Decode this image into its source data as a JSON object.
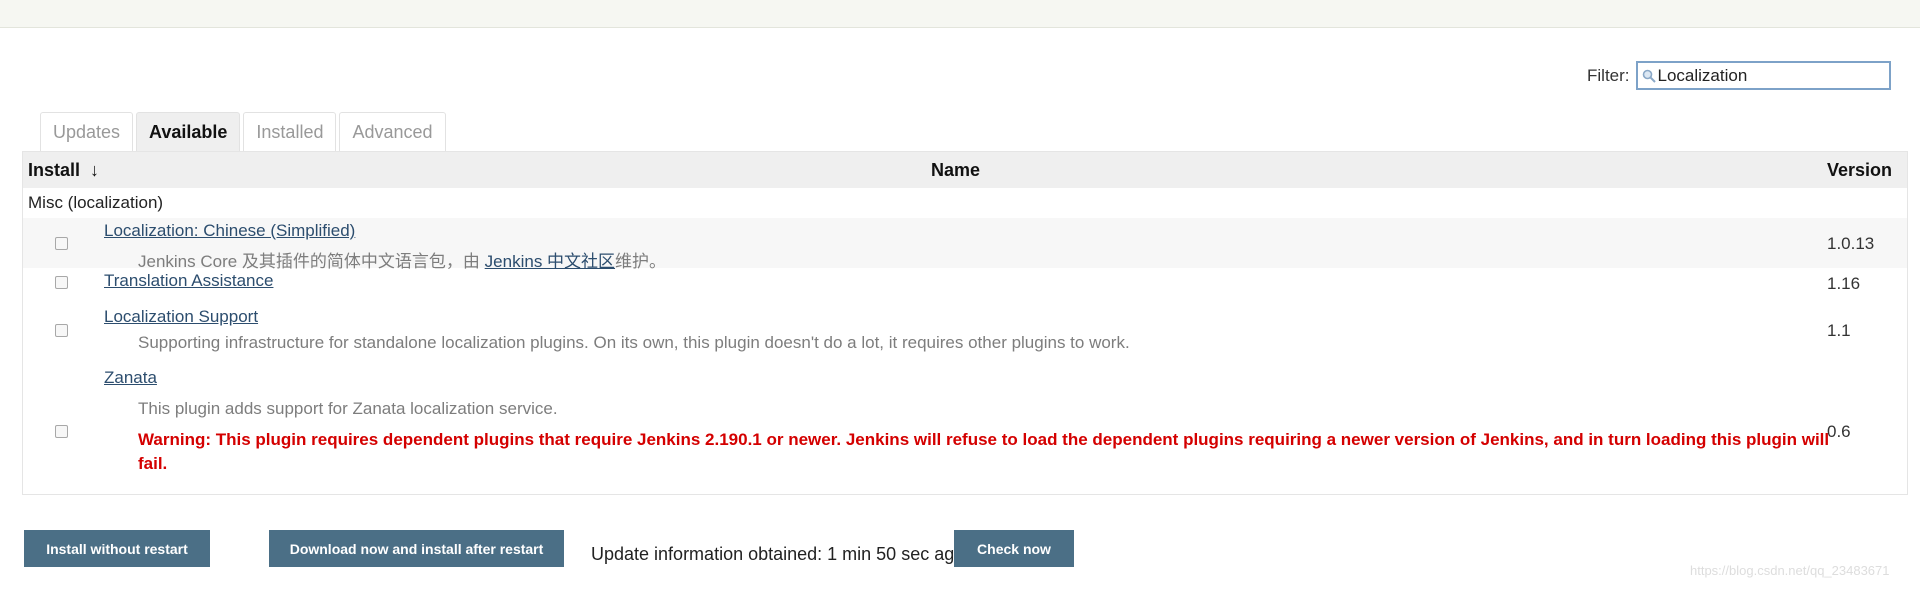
{
  "filter": {
    "label": "Filter:",
    "value": "Localization"
  },
  "tabs": [
    {
      "label": "Updates",
      "active": false
    },
    {
      "label": "Available",
      "active": true
    },
    {
      "label": "Installed",
      "active": false
    },
    {
      "label": "Advanced",
      "active": false
    }
  ],
  "table": {
    "headers": {
      "install": "Install",
      "sort_arrow": "↓",
      "name": "Name",
      "version": "Version"
    },
    "category": "Misc (localization)",
    "plugins": [
      {
        "name": "Localization: Chinese (Simplified)",
        "desc_prefix": "Jenkins Core 及其插件的简体中文语言包，由 ",
        "desc_link": "Jenkins 中文社区",
        "desc_suffix": "维护。",
        "version": "1.0.13"
      },
      {
        "name": "Translation Assistance",
        "version": "1.16"
      },
      {
        "name": "Localization Support",
        "desc": "Supporting infrastructure for standalone localization plugins. On its own, this plugin doesn't do a lot, it requires other plugins to work.",
        "version": "1.1"
      },
      {
        "name": "Zanata",
        "desc": "This plugin adds support for Zanata localization service.",
        "warning": "Warning: This plugin requires dependent plugins that require Jenkins 2.190.1 or newer. Jenkins will refuse to load the dependent plugins requiring a newer version of Jenkins, and in turn loading this plugin will fail.",
        "version": "0.6"
      }
    ]
  },
  "footer": {
    "install_without_restart": "Install without restart",
    "download_install_after_restart": "Download now and install after restart",
    "update_info": "Update information obtained: 1 min 50 sec ago",
    "check_now": "Check now"
  },
  "watermark": "https://blog.csdn.net/qq_23483671",
  "icons": {
    "filter": "search-icon"
  },
  "colors": {
    "button": "#4b6f86",
    "link": "#2c4d6e",
    "warning": "#d40000",
    "header_bg": "#efefef"
  }
}
